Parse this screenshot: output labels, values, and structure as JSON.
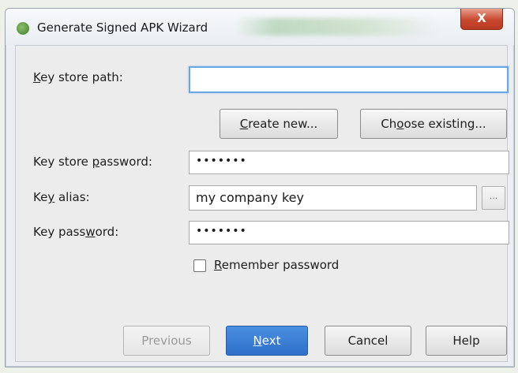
{
  "window": {
    "title": "Generate Signed APK Wizard",
    "close_glyph": "X"
  },
  "form": {
    "key_store_path": {
      "label_pre": "",
      "label_u": "K",
      "label_post": "ey store path:",
      "value": ""
    },
    "create_new": {
      "pre": "",
      "u": "C",
      "post": "reate new..."
    },
    "choose_existing": {
      "pre": "Ch",
      "u": "o",
      "post": "ose existing..."
    },
    "key_store_password": {
      "label_pre": "Key store ",
      "label_u": "p",
      "label_post": "assword:",
      "value": "•••••••"
    },
    "key_alias": {
      "label_pre": "Ke",
      "label_u": "y",
      "label_post": " alias:",
      "value": "my company key",
      "browse_glyph": "..."
    },
    "key_password": {
      "label_pre": "Key pass",
      "label_u": "w",
      "label_post": "ord:",
      "value": "•••••••"
    },
    "remember": {
      "pre": "",
      "u": "R",
      "post": "emember password",
      "checked": false
    }
  },
  "footer": {
    "previous": "Previous",
    "next": {
      "pre": "",
      "u": "N",
      "post": "ext"
    },
    "cancel": "Cancel",
    "help": "Help"
  }
}
